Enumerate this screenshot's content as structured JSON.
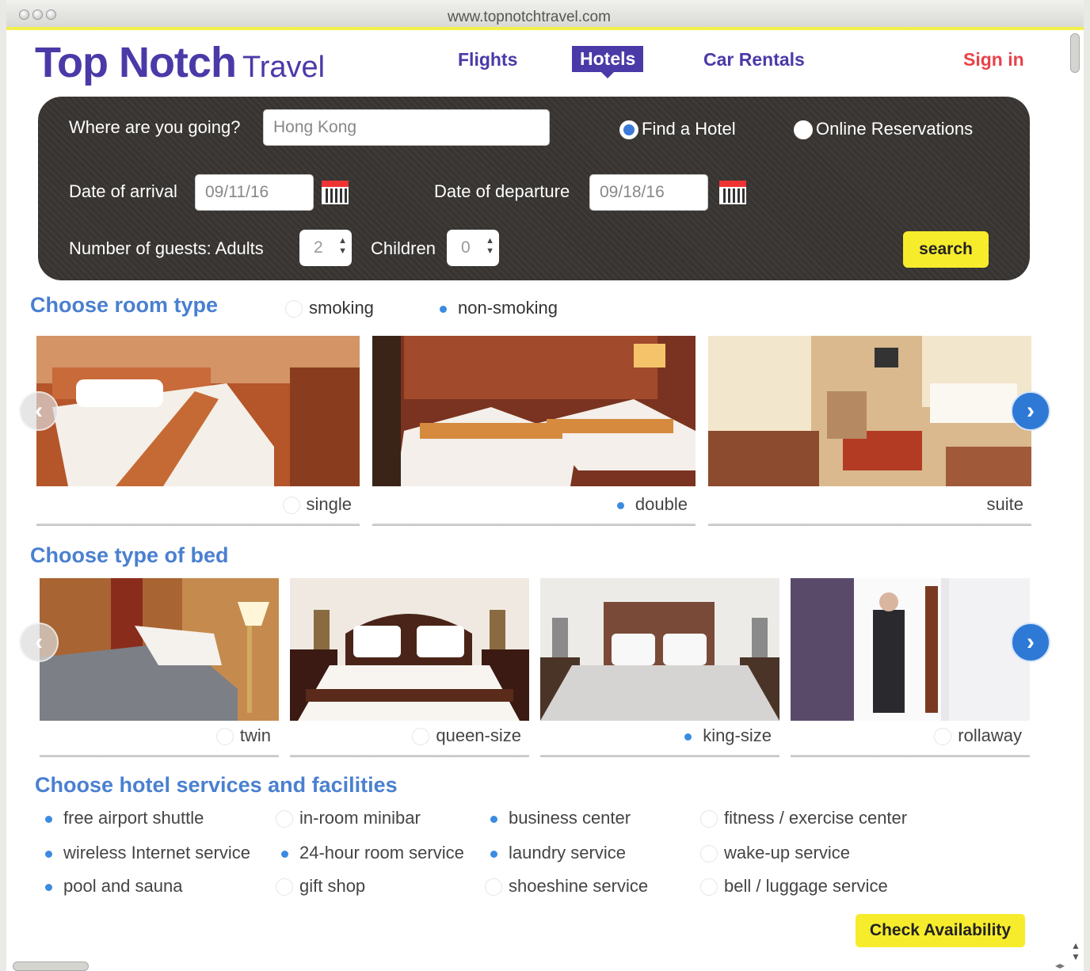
{
  "browser": {
    "url": "www.topnotchtravel.com"
  },
  "brand": {
    "name_bold": "Top Notch",
    "name_light": "Travel"
  },
  "nav": {
    "flights": "Flights",
    "hotels": "Hotels",
    "car_rentals": "Car Rentals",
    "sign_in": "Sign in"
  },
  "search": {
    "destination_label": "Where are you going?",
    "destination_value": "Hong Kong",
    "mode_find": "Find a Hotel",
    "mode_online": "Online Reservations",
    "arrival_label": "Date of arrival",
    "arrival_value": "09/11/16",
    "departure_label": "Date of departure",
    "departure_value": "09/18/16",
    "guests_label": "Number of guests: Adults",
    "adults_value": "2",
    "children_label": "Children",
    "children_value": "0",
    "search_button": "search"
  },
  "room_type": {
    "heading": "Choose room type",
    "smoking": "smoking",
    "non_smoking": "non-smoking",
    "rooms": [
      {
        "label": "single",
        "selected": false
      },
      {
        "label": "double",
        "selected": true
      },
      {
        "label": "suite",
        "selected": false
      }
    ]
  },
  "bed_type": {
    "heading": "Choose type of bed",
    "beds": [
      {
        "label": "twin",
        "selected": false
      },
      {
        "label": "queen-size",
        "selected": false
      },
      {
        "label": "king-size",
        "selected": true
      },
      {
        "label": "rollaway",
        "selected": false
      }
    ]
  },
  "services": {
    "heading": "Choose hotel services and facilities",
    "items": [
      {
        "label": "free airport shuttle",
        "selected": true
      },
      {
        "label": "in-room minibar",
        "selected": false
      },
      {
        "label": "business center",
        "selected": true
      },
      {
        "label": "fitness / exercise center",
        "selected": false
      },
      {
        "label": "wireless Internet service",
        "selected": true
      },
      {
        "label": "24-hour room service",
        "selected": true
      },
      {
        "label": "laundry service",
        "selected": true
      },
      {
        "label": "wake-up service",
        "selected": false
      },
      {
        "label": "pool and sauna",
        "selected": true
      },
      {
        "label": "gift shop",
        "selected": false
      },
      {
        "label": "shoeshine service",
        "selected": false
      },
      {
        "label": "bell / luggage service",
        "selected": false
      }
    ],
    "check_button": "Check Availability"
  },
  "icons": {
    "calendar": "calendar-icon",
    "carousel_next": "chevron-right-icon",
    "carousel_prev": "chevron-left-icon"
  },
  "colors": {
    "brand": "#4a3aa8",
    "accent_yellow": "#f7ec2c",
    "heading_blue": "#4a80d0",
    "sign_in_red": "#e8424a",
    "radio_blue": "#3b8be0"
  }
}
